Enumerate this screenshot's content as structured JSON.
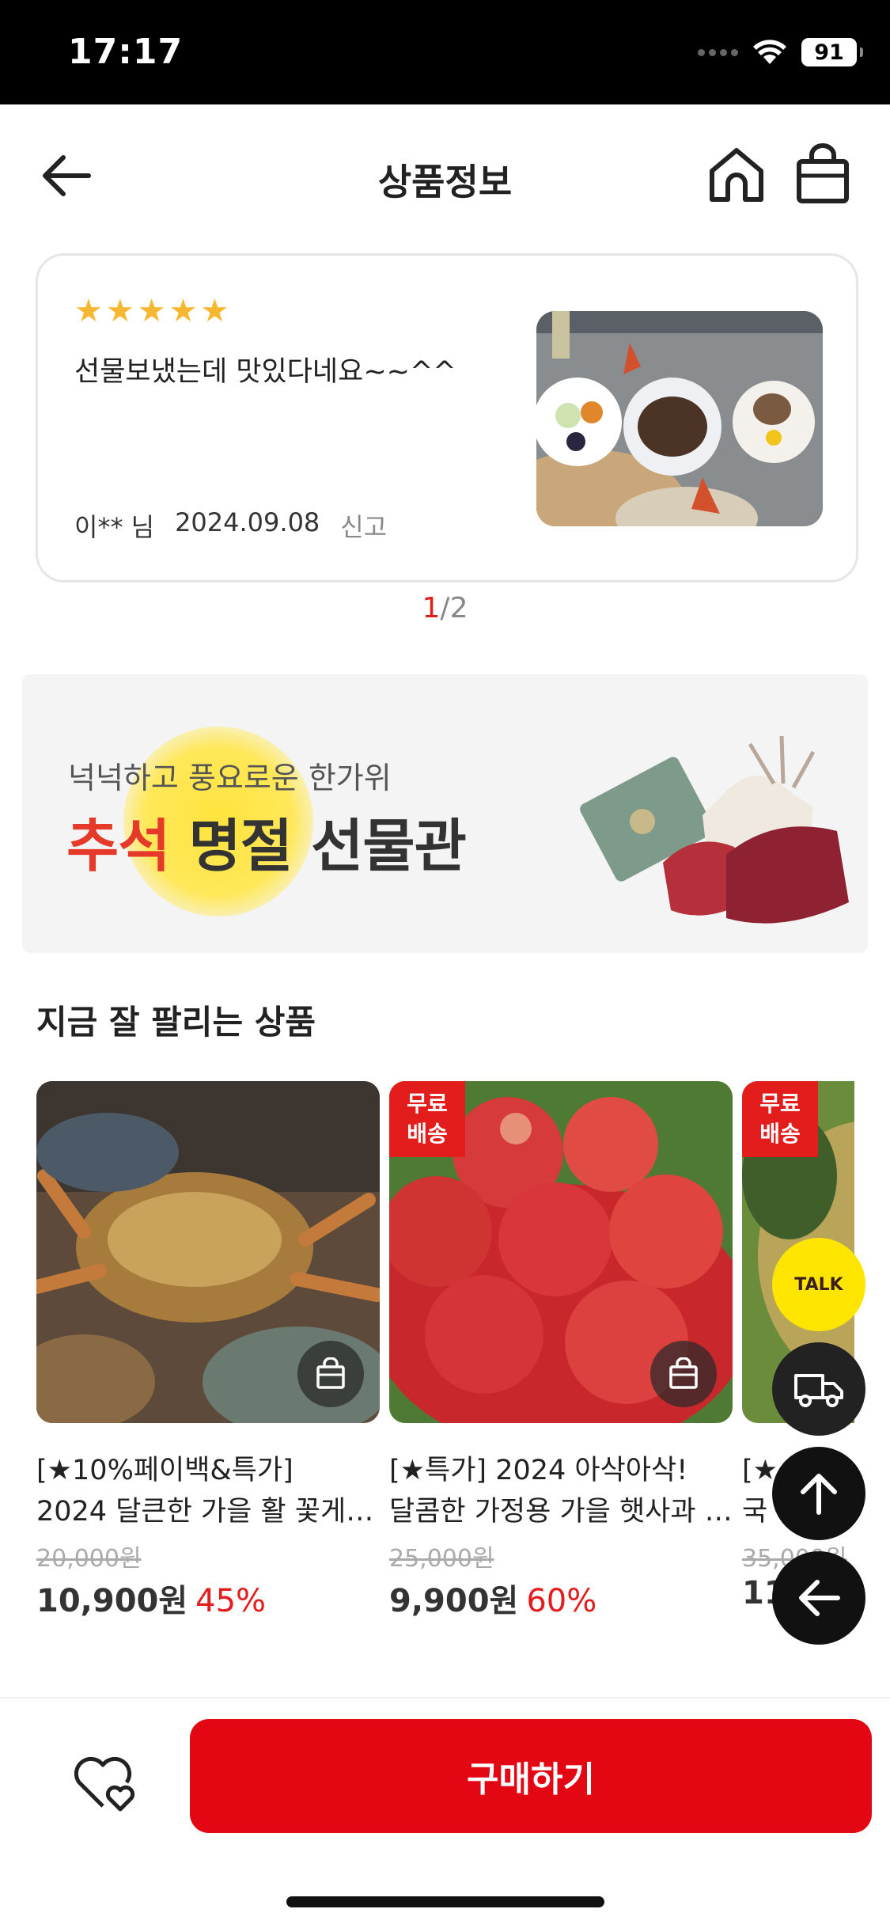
{
  "status_bar": {
    "time": "17:17",
    "battery": "91"
  },
  "header": {
    "title": "상품정보"
  },
  "review": {
    "stars": [
      "★",
      "★",
      "★",
      "★",
      "★"
    ],
    "text": "선물보냈는데 맛있다네요~~^^",
    "author": "이** 님",
    "date": "2024.09.08",
    "report_label": "신고"
  },
  "pager": {
    "current": "1",
    "separator": "/",
    "total": "2"
  },
  "banner": {
    "subtitle": "넉넉하고 풍요로운 한가위",
    "title_accent": "추석",
    "title_rest": " 명절 선물관"
  },
  "section": {
    "title": "지금 잘 팔리는 상품"
  },
  "products": [
    {
      "free_shipping": false,
      "name_line1": "[★10%페이백&특가]",
      "name_line2": "2024 달큰한 가을 활 꽃게 …",
      "original_price": "20,000원",
      "price": "10,900원",
      "discount": "45%"
    },
    {
      "free_shipping": true,
      "badge_line1": "무료",
      "badge_line2": "배송",
      "name_line1": "[★특가] 2024 아삭아삭!",
      "name_line2": "달콤한 가정용 가을 햇사과 …",
      "original_price": "25,000원",
      "price": "9,900원",
      "discount": "60%"
    },
    {
      "free_shipping": true,
      "badge_line1": "무료",
      "badge_line2": "배송",
      "name_line1": "[★",
      "name_line2": "국",
      "original_price": "35,000원",
      "price": "11",
      "discount": ""
    }
  ],
  "floating": {
    "talk_label": "TALK"
  },
  "bottom": {
    "buy_label": "구매하기"
  },
  "colors": {
    "accent": "#e31c1c",
    "buy": "#e30613",
    "star": "#f7b731",
    "kakao": "#fee500"
  }
}
